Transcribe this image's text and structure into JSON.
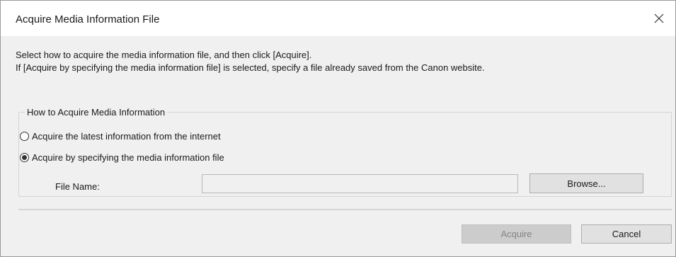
{
  "window": {
    "title": "Acquire Media Information File",
    "close_icon": "close-icon"
  },
  "instructions": {
    "line1": "Select how to acquire the media information file, and then click [Acquire].",
    "line2": "If [Acquire by specifying the media information file] is selected, specify a file already saved from the Canon website."
  },
  "group": {
    "legend": "How to Acquire Media Information",
    "options": [
      {
        "label": "Acquire the latest information from the internet",
        "selected": false
      },
      {
        "label": "Acquire by specifying the media information file",
        "selected": true
      }
    ]
  },
  "file": {
    "label": "File Name:",
    "value": "",
    "browse_label": "Browse..."
  },
  "footer": {
    "acquire_label": "Acquire",
    "acquire_disabled": true,
    "cancel_label": "Cancel"
  }
}
